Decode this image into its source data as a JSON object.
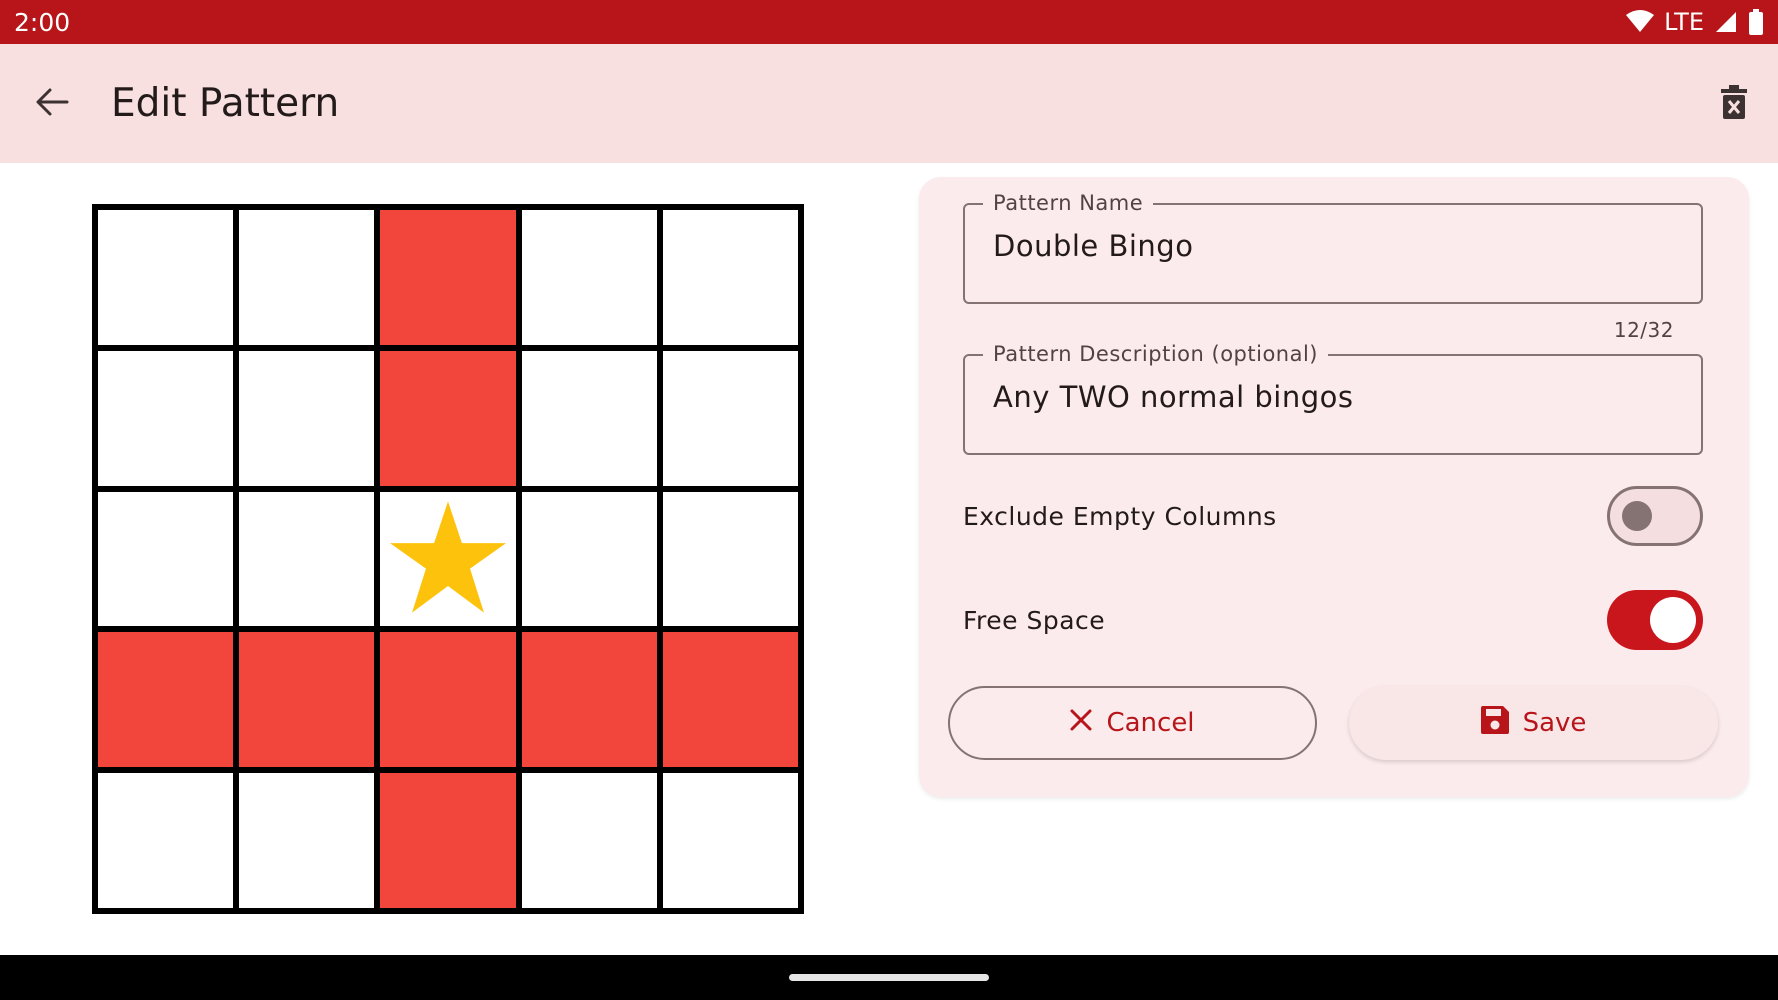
{
  "status_bar": {
    "time": "2:00",
    "network": "LTE",
    "icons": [
      "wifi-icon",
      "signal-icon",
      "battery-icon"
    ]
  },
  "app_bar": {
    "title": "Edit Pattern",
    "back_icon": "arrow-left-icon",
    "delete_icon": "delete-pattern-icon"
  },
  "pattern_grid": {
    "rows": 5,
    "cols": 5,
    "cells": [
      [
        0,
        0,
        1,
        0,
        0
      ],
      [
        0,
        0,
        1,
        0,
        0
      ],
      [
        0,
        0,
        0,
        0,
        0
      ],
      [
        1,
        1,
        1,
        1,
        1
      ],
      [
        0,
        0,
        1,
        0,
        0
      ]
    ],
    "free_space_icon": "star-icon",
    "active_color": "#f2453b",
    "star_color": "#fdc20b"
  },
  "form": {
    "name_field": {
      "label": "Pattern Name",
      "value": "Double Bingo",
      "counter": "12/32"
    },
    "description_field": {
      "label": "Pattern Description (optional)",
      "value": "Any TWO normal bingos"
    },
    "exclude_empty_columns": {
      "label": "Exclude Empty Columns",
      "checked": false
    },
    "free_space": {
      "label": "Free Space",
      "checked": true
    }
  },
  "actions": {
    "cancel_label": "Cancel",
    "save_label": "Save",
    "cancel_icon": "close-icon",
    "save_icon": "floppy-disk-icon"
  },
  "colors": {
    "primary": "#b71519",
    "app_bar_bg": "#f8dfe0",
    "card_bg": "#fcebec",
    "outline": "#857373"
  }
}
